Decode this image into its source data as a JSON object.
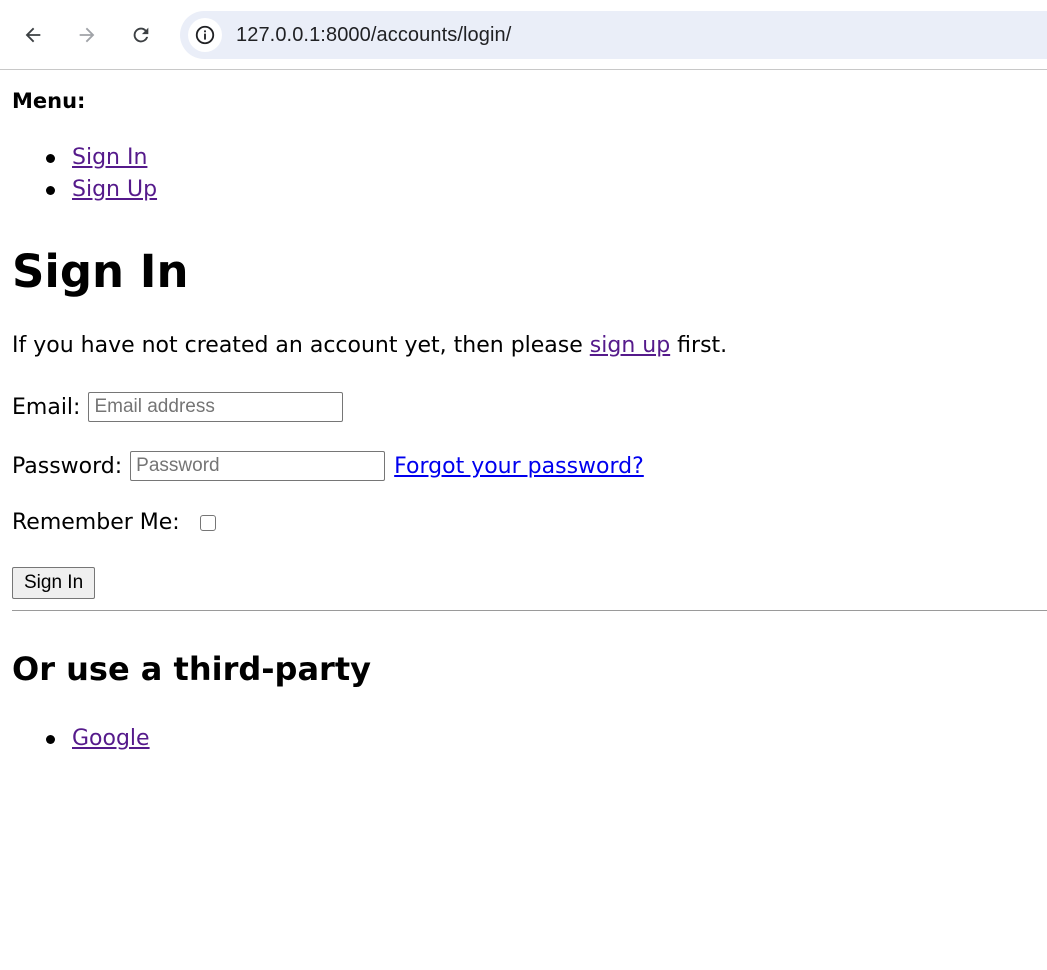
{
  "browser": {
    "url": "127.0.0.1:8000/accounts/login/",
    "icons": [
      "back-arrow-icon",
      "forward-arrow-icon",
      "reload-icon",
      "site-info-icon"
    ]
  },
  "menu": {
    "title": "Menu:",
    "items": [
      {
        "label": "Sign In"
      },
      {
        "label": "Sign Up"
      }
    ]
  },
  "page_title": "Sign In",
  "intro": {
    "before": "If you have not created an account yet, then please ",
    "link": "sign up",
    "after": " first."
  },
  "form": {
    "email": {
      "label": "Email:",
      "placeholder": "Email address",
      "value": ""
    },
    "password": {
      "label": "Password:",
      "placeholder": "Password",
      "value": "",
      "forgot_link": "Forgot your password?"
    },
    "remember": {
      "label": "Remember Me:",
      "checked": false
    },
    "submit_label": "Sign In"
  },
  "third_party": {
    "heading": "Or use a third-party",
    "providers": [
      {
        "label": "Google"
      }
    ]
  },
  "colors": {
    "visited_link": "#551a8b",
    "unvisited_link": "#0000ee",
    "omnibox_bg": "#eaeef8"
  }
}
